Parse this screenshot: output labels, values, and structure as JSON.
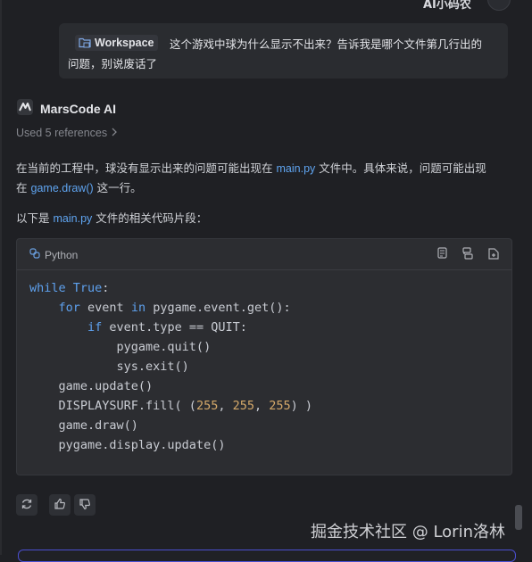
{
  "header": {
    "username": "AI小码农"
  },
  "user_message": {
    "context_pill": "Workspace",
    "line1": "这个游戏中球为什么显示不出来？告诉我是哪个文件第几行出的",
    "line2": "问题，别说废话了"
  },
  "assistant": {
    "name": "MarsCode AI",
    "references": "Used 5 references",
    "p1_a": "在当前的工程中，球没有显示出来的问题可能出现在",
    "p1_code": "main.py",
    "p1_b": "文件中。具体来说，问题可能出现",
    "p2_a": "在",
    "p2_code": "game.draw()",
    "p2_b": "这一行。",
    "p3_a": "以下是",
    "p3_code": "main.py",
    "p3_b": "文件的相关代码片段："
  },
  "code_block": {
    "language": "Python",
    "lines": [
      "while True:",
      "    for event in pygame.event.get():",
      "        if event.type == QUIT:",
      "            pygame.quit()",
      "            sys.exit()",
      "    game.update()",
      "    DISPLAYSURF.fill( (255, 255, 255) )",
      "    game.draw()",
      "    pygame.display.update()"
    ]
  },
  "actions": [
    "refresh-icon",
    "thumbs-up-icon",
    "thumbs-down-icon"
  ],
  "watermark": "掘金技术社区 @ Lorin洛林",
  "colors": {
    "background": "#1f2024",
    "accent": "#5fa4f0",
    "input_border": "#4b4fd0"
  }
}
